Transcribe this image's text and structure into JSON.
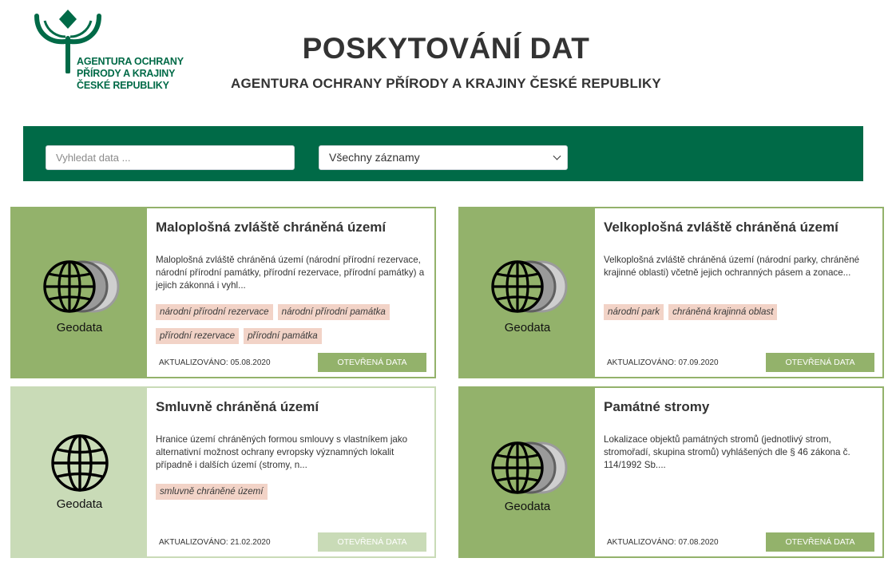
{
  "header": {
    "logo_lines": [
      "AGENTURA OCHRANY",
      "PŘÍRODY A KRAJINY",
      "ČESKÉ REPUBLIKY"
    ],
    "title": "POSKYTOVÁNÍ DAT",
    "subtitle": "AGENTURA OCHRANY PŘÍRODY A KRAJINY ČESKÉ REPUBLIKY"
  },
  "filters": {
    "search_placeholder": "Vyhledat data ...",
    "search_value": "",
    "select_value": "Všechny záznamy"
  },
  "colors": {
    "brand_green": "#006a47",
    "card_green": "#93b26b",
    "card_green_light": "#c9dbb7",
    "tag_bg": "#f2d3c7"
  },
  "cards": [
    {
      "title": "Maloplošná zvláště chráněná území",
      "description": "Maloplošná zvláště chráněná území (národní přírodní rezervace, národní přírodní památky, přírodní rezervace, přírodní památky) a jejich zákonná i vyhl...",
      "media_label": "Geodata",
      "icon": "globe-stack-icon",
      "tags": [
        "národní přírodní rezervace",
        "národní přírodní památka",
        "přírodní rezervace",
        "přírodní památka"
      ],
      "updated": "AKTUALIZOVÁNO: 05.08.2020",
      "button": "OTEVŘENÁ DATA"
    },
    {
      "title": "Velkoplošná zvláště chráněná území",
      "description": "Velkoplošná zvláště chráněná území (národní parky, chráněné krajinné oblasti) včetně jejich ochranných pásem a zonace...",
      "media_label": "Geodata",
      "icon": "globe-stack-icon",
      "tags": [
        "národní park",
        "chráněná krajinná oblast"
      ],
      "updated": "AKTUALIZOVÁNO: 07.09.2020",
      "button": "OTEVŘENÁ DATA"
    },
    {
      "title": "Smluvně chráněná území",
      "description": "Hranice území chráněných formou smlouvy s vlastníkem jako alternativní možnost ochrany evropsky významných lokalit případně i dalších území (stromy, n...",
      "media_label": "Geodata",
      "icon": "globe-icon",
      "tags": [
        "smluvně chráněné území"
      ],
      "updated": "AKTUALIZOVÁNO: 21.02.2020",
      "button": "OTEVŘENÁ DATA"
    },
    {
      "title": "Památné stromy",
      "description": "Lokalizace objektů památných stromů (jednotlivý strom, stromořadí, skupina stromů) vyhlášených dle § 46 zákona č. 114/1992 Sb....",
      "media_label": "Geodata",
      "icon": "globe-stack-icon",
      "tags": [],
      "updated": "AKTUALIZOVÁNO: 07.08.2020",
      "button": "OTEVŘENÁ DATA"
    }
  ]
}
